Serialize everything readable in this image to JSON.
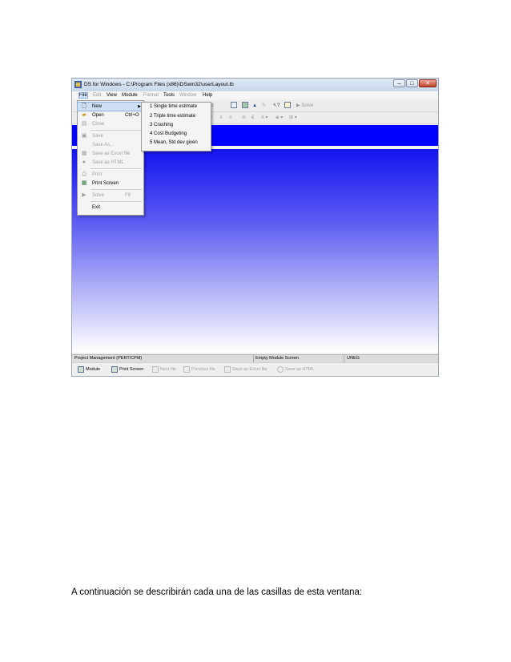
{
  "window": {
    "title": "DS for Windows - C:\\Program Files (x86)\\DSwin32\\userLayout.tb",
    "controls": [
      "–",
      "□",
      "✕"
    ]
  },
  "menubar": [
    {
      "label": "File",
      "state": "active"
    },
    {
      "label": "Edit",
      "state": "disabled"
    },
    {
      "label": "View",
      "state": "normal"
    },
    {
      "label": "Module",
      "state": "normal"
    },
    {
      "label": "Format",
      "state": "disabled"
    },
    {
      "label": "Tools",
      "state": "normal"
    },
    {
      "label": "Window",
      "state": "disabled"
    },
    {
      "label": "Help",
      "state": "normal"
    }
  ],
  "file_menu": {
    "items": [
      {
        "label": "New",
        "shortcut": "",
        "has_submenu": true,
        "disabled": false,
        "icon": "new-document-icon"
      },
      {
        "label": "Open",
        "shortcut": "Ctrl+O",
        "has_submenu": false,
        "disabled": false,
        "icon": "open-folder-icon"
      },
      {
        "label": "Close",
        "shortcut": "",
        "has_submenu": false,
        "disabled": true,
        "icon": "close-file-icon"
      },
      {
        "label": "Save",
        "shortcut": "",
        "has_submenu": false,
        "disabled": true,
        "icon": "save-icon"
      },
      {
        "label": "Save As...",
        "shortcut": "",
        "has_submenu": false,
        "disabled": true,
        "icon": ""
      },
      {
        "label": "Save as Excel file",
        "shortcut": "",
        "has_submenu": false,
        "disabled": true,
        "icon": "excel-icon"
      },
      {
        "label": "Save as HTML",
        "shortcut": "",
        "has_submenu": false,
        "disabled": true,
        "icon": "html-icon"
      },
      {
        "label": "Print",
        "shortcut": "",
        "has_submenu": false,
        "disabled": true,
        "icon": "print-icon"
      },
      {
        "label": "Print Screen",
        "shortcut": "",
        "has_submenu": false,
        "disabled": false,
        "icon": "print-screen-icon"
      },
      {
        "label": "Solve",
        "shortcut": "F9",
        "has_submenu": false,
        "disabled": true,
        "icon": "solve-icon"
      },
      {
        "label": "Exit",
        "shortcut": "",
        "has_submenu": false,
        "disabled": false,
        "icon": ""
      }
    ]
  },
  "new_submenu": {
    "items": [
      "1 Single time estimate",
      "2 Triple time estimate",
      "3 Crashing",
      "4 Cost Budgeting",
      "5 Mean, Std dev given"
    ]
  },
  "toolbar": {
    "solve_label": "Solve",
    "help_label": "?"
  },
  "status_bar": {
    "module": "Project Management (PERT/CPM)",
    "screen": "Empty Module Screen",
    "user": "UNEG"
  },
  "bottom_bar": [
    {
      "label": "Module",
      "disabled": false
    },
    {
      "label": "Print Screen",
      "disabled": false
    },
    {
      "label": "Next file",
      "disabled": true
    },
    {
      "label": "Previous file",
      "disabled": true
    },
    {
      "label": "Save as Excel file",
      "disabled": true
    },
    {
      "label": "Save as HTML",
      "disabled": true
    }
  ],
  "caption": "A continuación se describirán cada una de las casillas de esta ventana:",
  "colors": {
    "workspace_top": "#1414f0",
    "workspace_band": "#0000ff",
    "menu_highlight": "#cfe0f6"
  }
}
